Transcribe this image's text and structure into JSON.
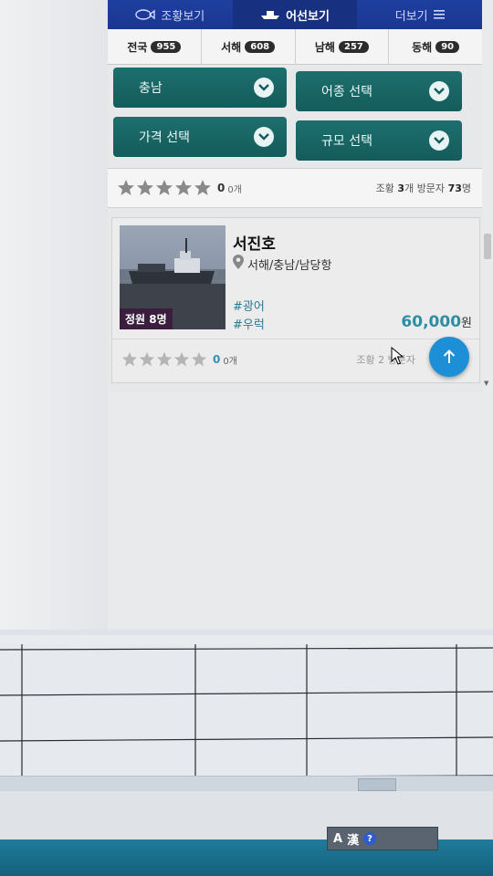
{
  "nav": {
    "tabs": [
      {
        "label": "조황보기",
        "icon": "fish-icon"
      },
      {
        "label": "어선보기",
        "icon": "boat-icon"
      },
      {
        "label": "더보기",
        "icon": "menu-icon"
      }
    ]
  },
  "regions": [
    {
      "label": "전국",
      "count": "955"
    },
    {
      "label": "서해",
      "count": "608"
    },
    {
      "label": "남해",
      "count": "257"
    },
    {
      "label": "동해",
      "count": "90"
    }
  ],
  "filters": {
    "region": "충남",
    "fish_type": "어종 선택",
    "price": "가격 선택",
    "size": "규모 선택"
  },
  "summary": {
    "rating": "0",
    "review_count": "0개",
    "catch_label": "조황",
    "catch_value": "3",
    "catch_unit": "개",
    "visitors_label": "방문자",
    "visitors_value": "73",
    "visitors_unit": "명"
  },
  "listing": {
    "name": "서진호",
    "location": "서해/충남/남당항",
    "capacity": "정원 8명",
    "tags": [
      "#광어",
      "#우럭"
    ],
    "price": "60,000",
    "price_unit": "원",
    "rating": "0",
    "review_count": "0개",
    "catch_label": "조황",
    "catch_value": "2",
    "visitors_label": "방문자"
  },
  "ime": {
    "label_a": "A",
    "label_han": "漢",
    "help": "?"
  },
  "colors": {
    "nav_blue": "#1f3fa0",
    "filter_teal": "#1d6f6e",
    "accent_blue": "#2d8ea6",
    "fab_blue": "#1d8fd6"
  }
}
